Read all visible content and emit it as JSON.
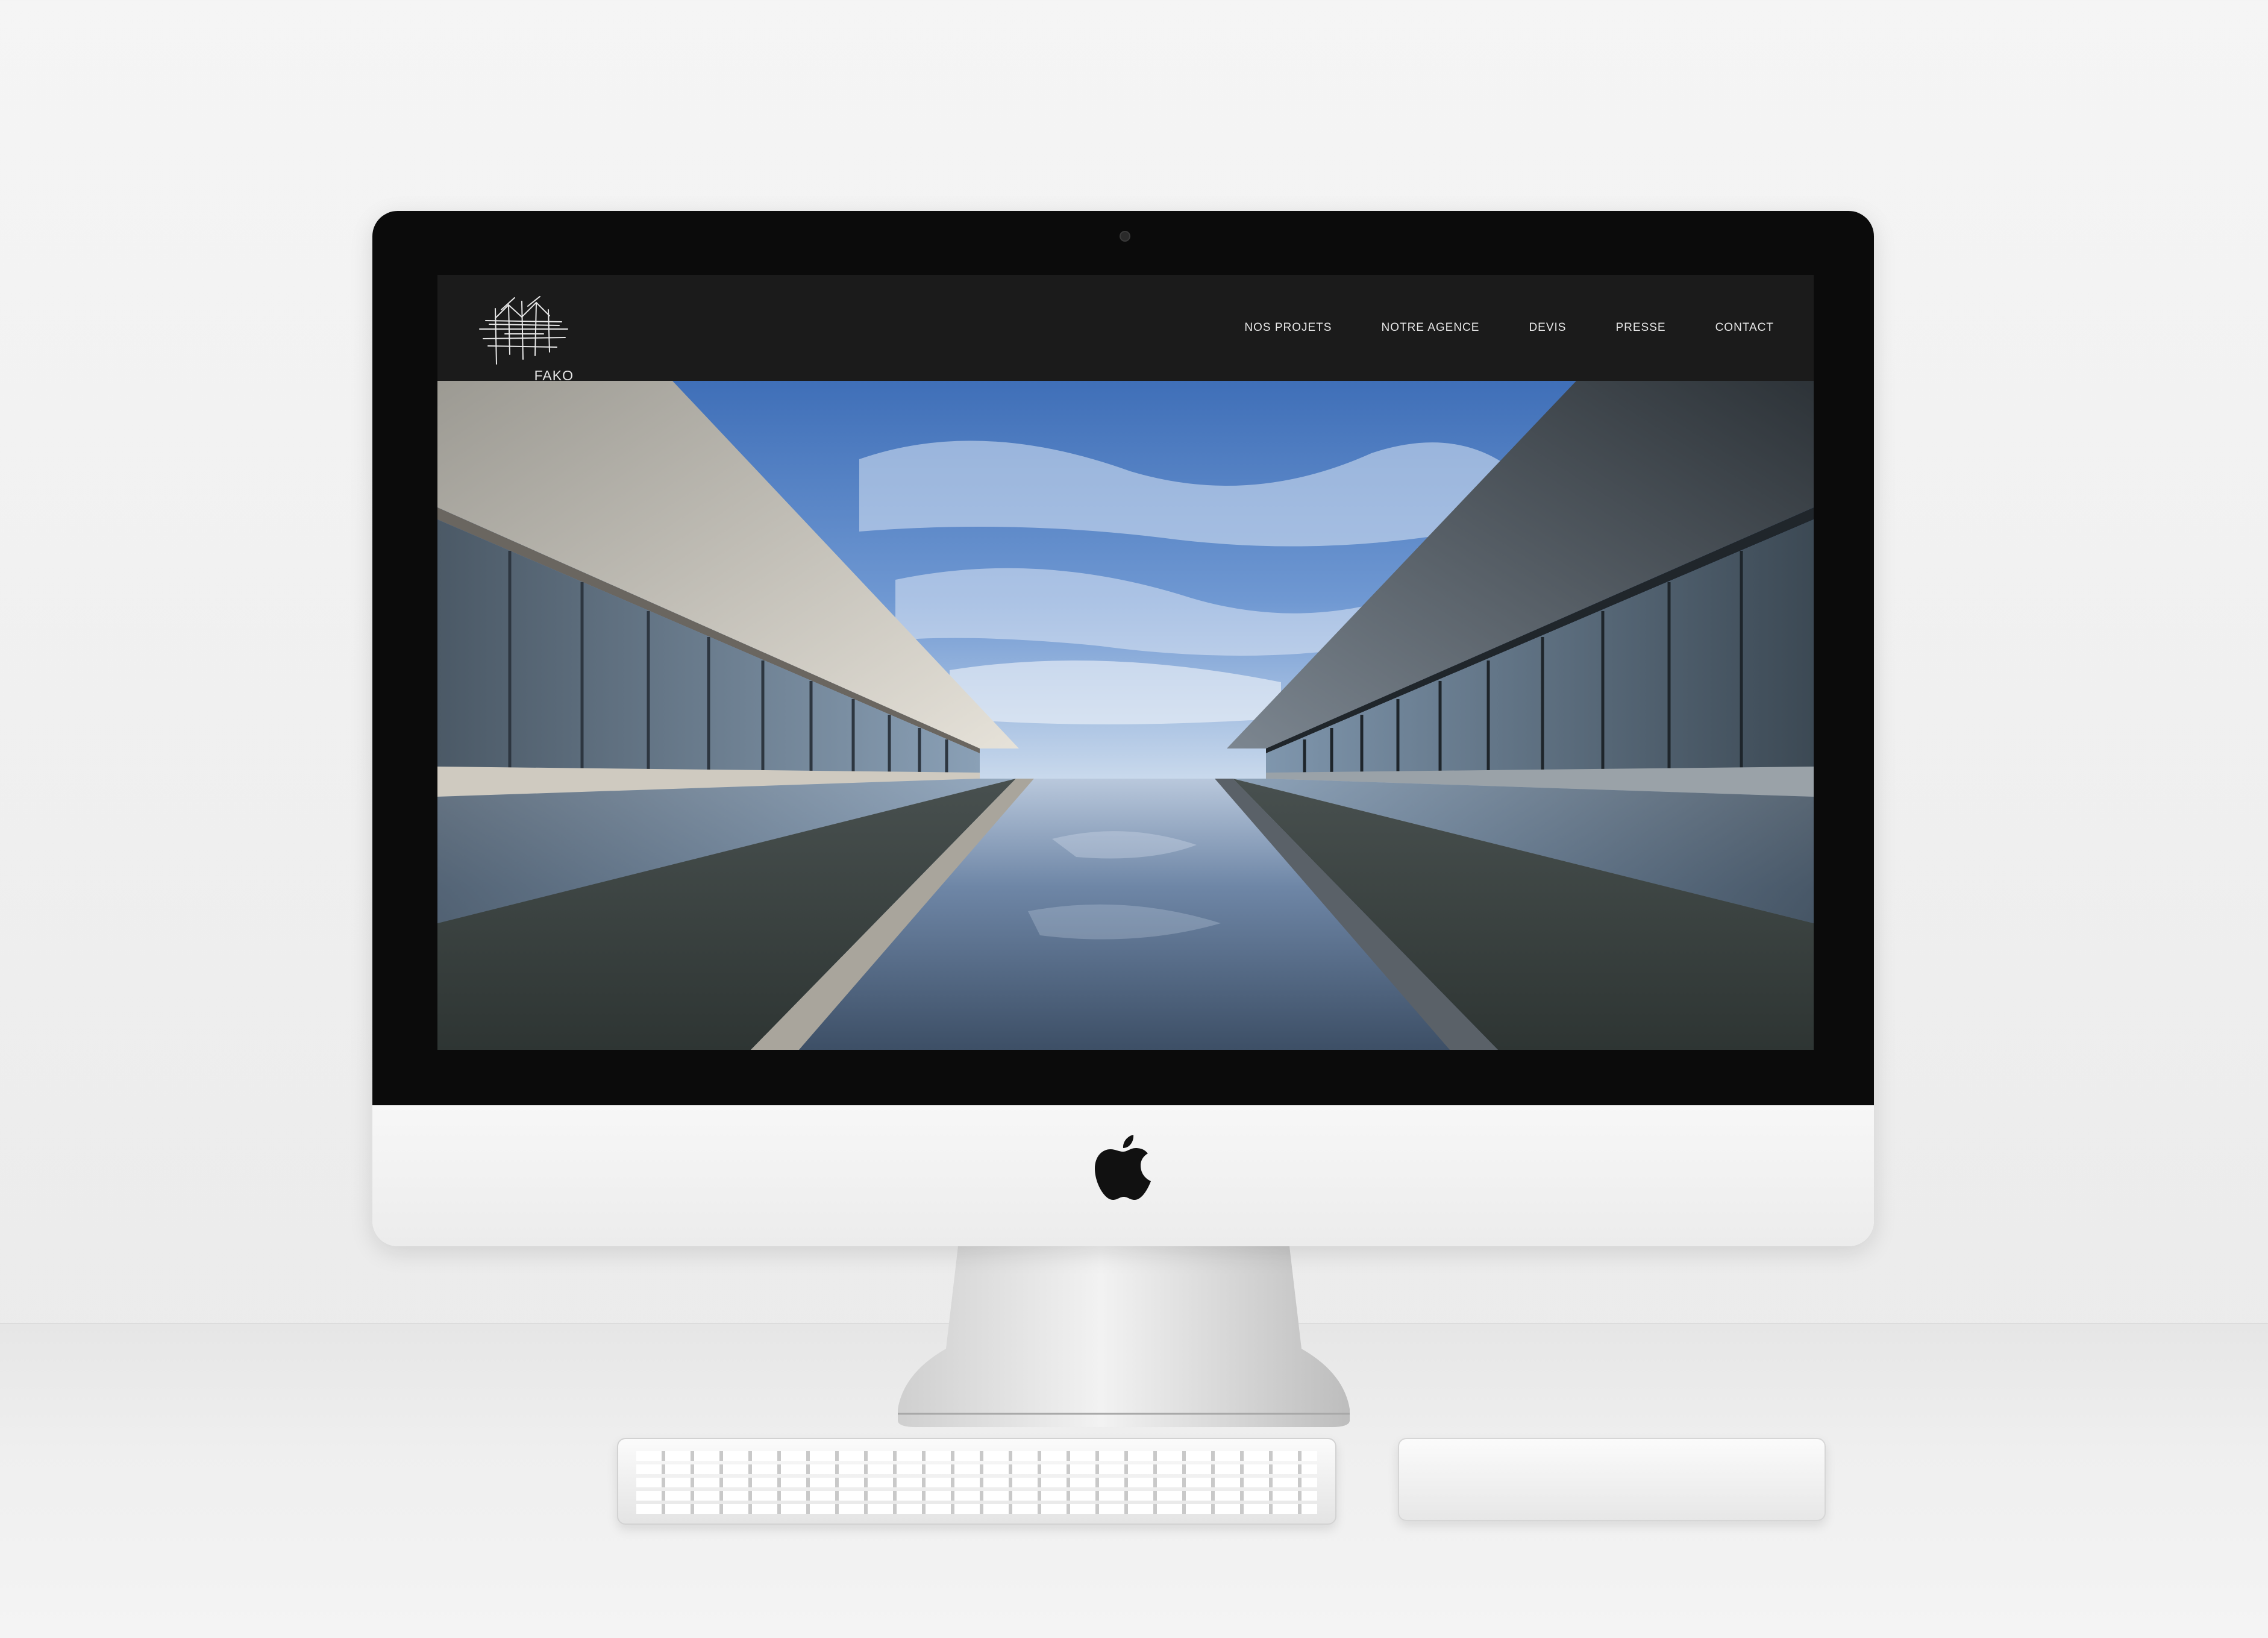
{
  "site": {
    "logo_text": "FAKO",
    "nav": [
      "NOS PROJETS",
      "NOTRE AGENCE",
      "DEVIS",
      "PRESSE",
      "CONTACT"
    ]
  },
  "icons": {
    "logo": "architectural-sketch-logo-icon",
    "device_logo": "apple-logo-icon"
  },
  "colors": {
    "header_bg": "#1b1b1b",
    "nav_text": "#e8e8e8",
    "sky": "#5c86c8"
  }
}
